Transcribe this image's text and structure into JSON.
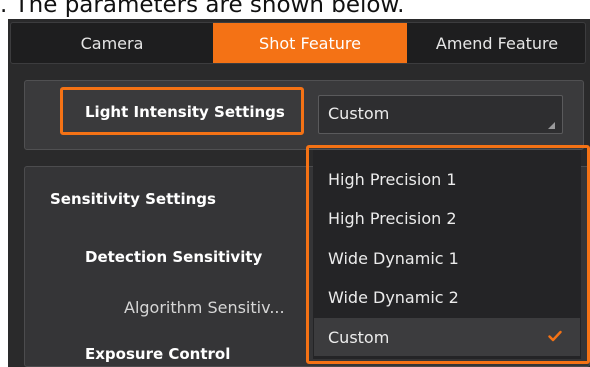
{
  "caption": ". The parameters are shown below.",
  "tabs": [
    {
      "label": "Camera",
      "active": false
    },
    {
      "label": "Shot Feature",
      "active": true
    },
    {
      "label": "Amend Feature",
      "active": false
    }
  ],
  "light_intensity": {
    "label": "Light Intensity Settings",
    "value": "Custom"
  },
  "tree": {
    "sensitivity_settings": "Sensitivity Settings",
    "detection_sensitivity": "Detection Sensitivity",
    "algorithm_sensitivity": "Algorithm Sensitiv...",
    "exposure_control": "Exposure Control"
  },
  "dropdown": {
    "options": [
      {
        "label": "High Precision 1"
      },
      {
        "label": "High Precision 2"
      },
      {
        "label": "Wide Dynamic 1"
      },
      {
        "label": "Wide Dynamic 2"
      },
      {
        "label": "Custom",
        "selected": true
      }
    ]
  },
  "colors": {
    "accent": "#f47215",
    "panel_bg": "#2a2a2b",
    "dropdown_bg": "#242426",
    "text": "#ececec"
  }
}
